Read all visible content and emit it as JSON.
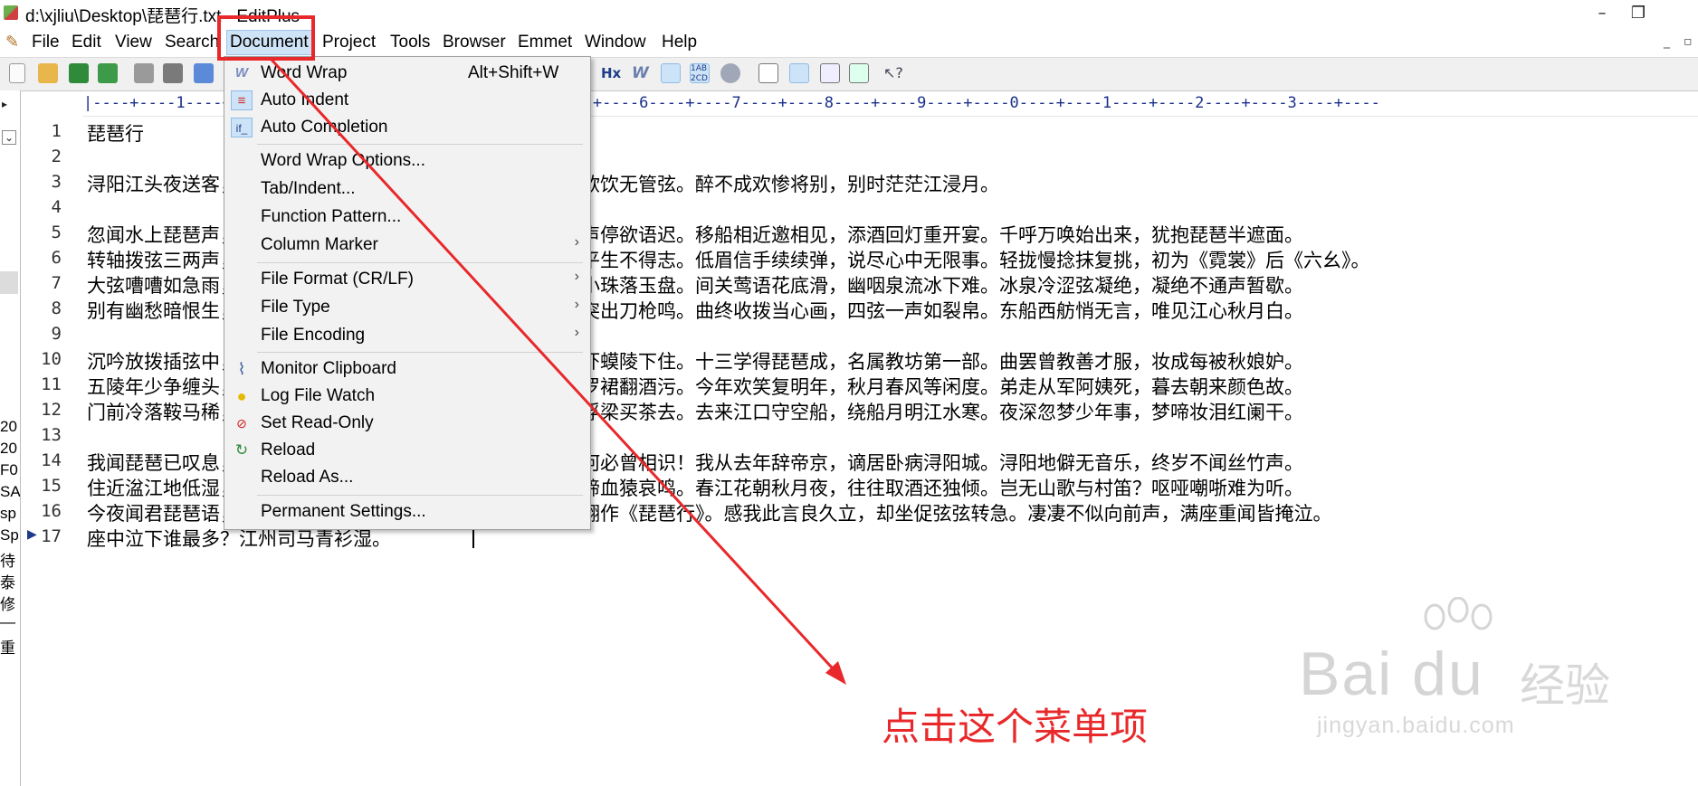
{
  "window": {
    "title": "d:\\xjliu\\Desktop\\琵琶行.txt - EditPlus",
    "minimize": "–",
    "restore": "❐"
  },
  "menubar": {
    "items": [
      "File",
      "Edit",
      "View",
      "Search",
      "Document",
      "Project",
      "Tools",
      "Browser",
      "Emmet",
      "Window",
      "Help"
    ],
    "active": "Document",
    "doc_min": "_",
    "doc_restore": "▫"
  },
  "ruler": "|----+----1----+----2----+----3----+----4----+----5----+----6----+----7----+----8----+----9----+----0----+----1----+----2----+----3----+----",
  "left_panel": {
    "items": [
      "20",
      "20",
      "F0",
      "SA",
      "sp",
      "Sp",
      "待",
      "泰",
      "修",
      "—",
      "重"
    ]
  },
  "editor": {
    "lines": [
      {
        "num": "1",
        "text": " 琵琶行"
      },
      {
        "num": "2",
        "text": ""
      },
      {
        "num": "3",
        "text": " 浔阳江头夜送客，枫叶荻花秋瑟瑟。主人下马客在船，举酒欲饮无管弦。醉不成欢惨将别，别时茫茫江浸月。"
      },
      {
        "num": "4",
        "text": ""
      },
      {
        "num": "5",
        "text": "忽闻水上琵琶声，主人忘归客不发。寻声暗问弹者谁，琵琶声停欲语迟。移船相近邀相见，添酒回灯重开宴。千呼万唤始出来，犹抱琵琶半遮面。"
      },
      {
        "num": "6",
        "text": "转轴拨弦三两声，未成曲调先有情。弦弦掩抑声声思，似诉平生不得志。低眉信手续续弹，说尽心中无限事。轻拢慢捻抹复挑，初为《霓裳》后《六幺》。"
      },
      {
        "num": "7",
        "text": "大弦嘈嘈如急雨，小弦切切如私语。嘈嘈切切错杂弹，大珠小珠落玉盘。间关莺语花底滑，幽咽泉流冰下难。冰泉冷涩弦凝绝，凝绝不通声暂歇。"
      },
      {
        "num": "8",
        "text": "别有幽愁暗恨生，此时无声胜有声。银瓶乍破水浆迸，铁骑突出刀枪鸣。曲终收拨当心画，四弦一声如裂帛。东船西舫悄无言，唯见江心秋月白。"
      },
      {
        "num": "9",
        "text": ""
      },
      {
        "num": "10",
        "text": "沉吟放拨插弦中，整顿衣裳起敛容。自言本是京城女，家在虾蟆陵下住。十三学得琵琶成，名属教坊第一部。曲罢曾教善才服，妆成每被秋娘妒。"
      },
      {
        "num": "11",
        "text": "五陵年少争缠头，一曲红绡不知数。钿头银篦击节碎，血色罗裙翻酒污。今年欢笑复明年，秋月春风等闲度。弟走从军阿姨死，暮去朝来颜色故。"
      },
      {
        "num": "12",
        "text": "门前冷落鞍马稀，老大嫁作商人妇。商人重利轻别离，前月浮梁买茶去。去来江口守空船，绕船月明江水寒。夜深忽梦少年事，梦啼妆泪红阑干。"
      },
      {
        "num": "13",
        "text": ""
      },
      {
        "num": "14",
        "text": "我闻琵琶已叹息，又闻此语重唧唧。同是天涯沦落人，相逢何必曾相识！我从去年辞帝京，谪居卧病浔阳城。浔阳地僻无音乐，终岁不闻丝竹声。"
      },
      {
        "num": "15",
        "text": "住近湓江地低湿，黄芦苦竹绕宅生。其间旦暮闻何物？杜鹃啼血猿哀鸣。春江花朝秋月夜，往往取酒还独倾。岂无山歌与村笛？呕哑嘲哳难为听。"
      },
      {
        "num": "16",
        "text": "今夜闻君琵琶语，如听仙乐耳暂明。莫辞更坐弹一曲，为君翻作《琵琶行》。感我此言良久立，却坐促弦弦转急。凄凄不似向前声，满座重闻皆掩泣。"
      },
      {
        "num": "17",
        "text": "座中泣下谁最多？江州司马青衫湿。"
      }
    ]
  },
  "document_menu": {
    "items": [
      {
        "label": "Word Wrap",
        "shortcut": "Alt+Shift+W",
        "icon": "word-wrap-icon"
      },
      {
        "label": "Auto Indent",
        "icon": "auto-indent-icon"
      },
      {
        "label": "Auto Completion",
        "icon": "auto-completion-icon"
      },
      {
        "label": "Word Wrap Options..."
      },
      {
        "label": "Tab/Indent..."
      },
      {
        "label": "Function Pattern..."
      },
      {
        "label": "Column Marker",
        "submenu": true
      },
      {
        "label": "File Format (CR/LF)",
        "submenu": true
      },
      {
        "label": "File Type",
        "submenu": true
      },
      {
        "label": "File Encoding",
        "submenu": true
      },
      {
        "label": "Monitor Clipboard",
        "icon": "paperclip-icon"
      },
      {
        "label": "Log File Watch",
        "icon": "lightbulb-icon"
      },
      {
        "label": "Set Read-Only",
        "icon": "read-only-icon"
      },
      {
        "label": "Reload",
        "icon": "reload-icon"
      },
      {
        "label": "Reload As..."
      },
      {
        "label": "Permanent Settings..."
      }
    ],
    "submenu_glyph": "›"
  },
  "annotation": {
    "text": "点击这个菜单项",
    "color": "#e8282a"
  },
  "watermark": {
    "brand": "Bai du",
    "cn": "经验",
    "url": "jingyan.baidu.com"
  }
}
